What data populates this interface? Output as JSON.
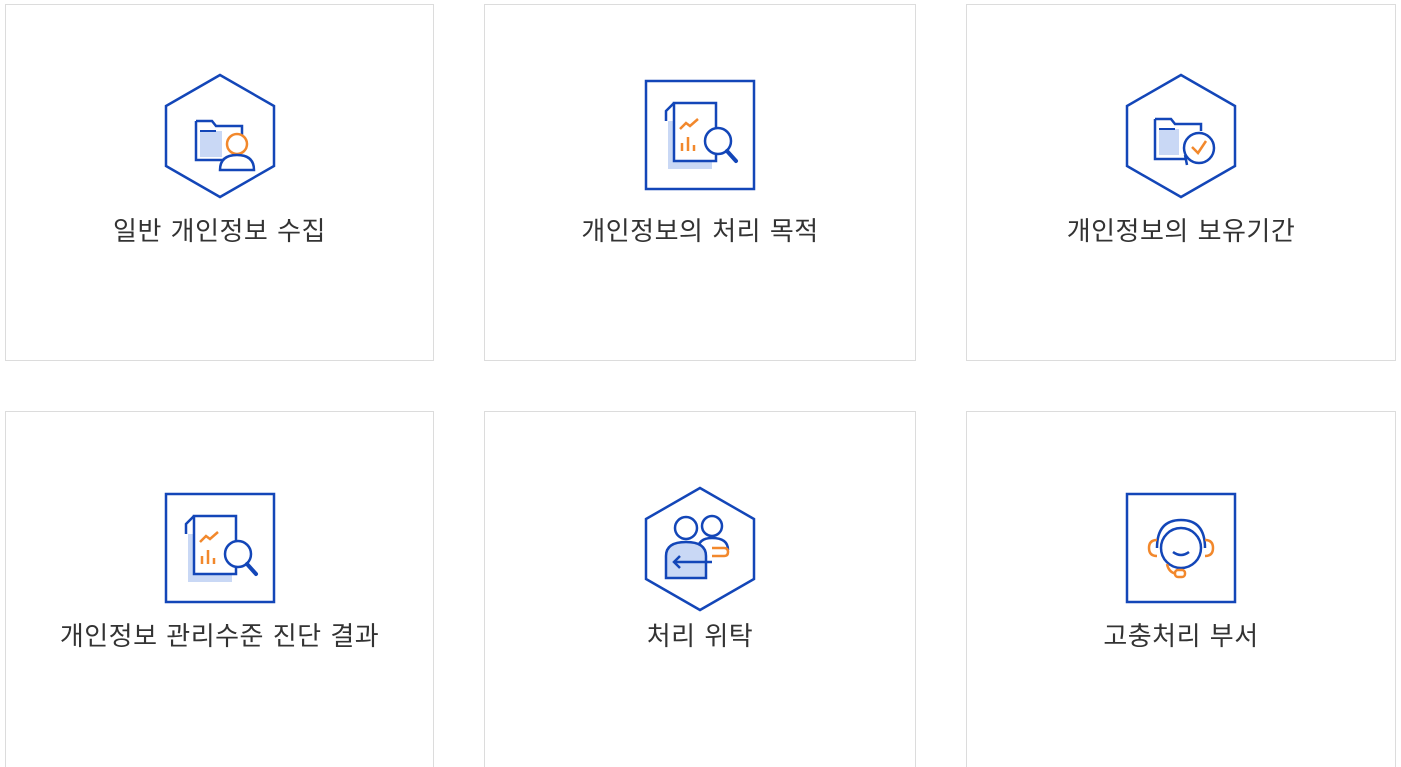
{
  "cards": [
    {
      "label": "일반 개인정보 수집",
      "icon": "folder-person-hexagon-icon"
    },
    {
      "label": "개인정보의 처리 목적",
      "icon": "report-search-square-icon"
    },
    {
      "label": "개인정보의 보유기간",
      "icon": "folder-clock-hexagon-icon"
    },
    {
      "label": "개인정보 관리수준 진단 결과",
      "icon": "report-search-square-icon"
    },
    {
      "label": "처리 위탁",
      "icon": "people-transfer-hexagon-icon"
    },
    {
      "label": "고충처리 부서",
      "icon": "headset-square-icon"
    }
  ],
  "colors": {
    "primary": "#1346b8",
    "accent": "#f2882c",
    "fill": "#c9d8f5",
    "border": "#dcdcdc",
    "text": "#333333"
  }
}
